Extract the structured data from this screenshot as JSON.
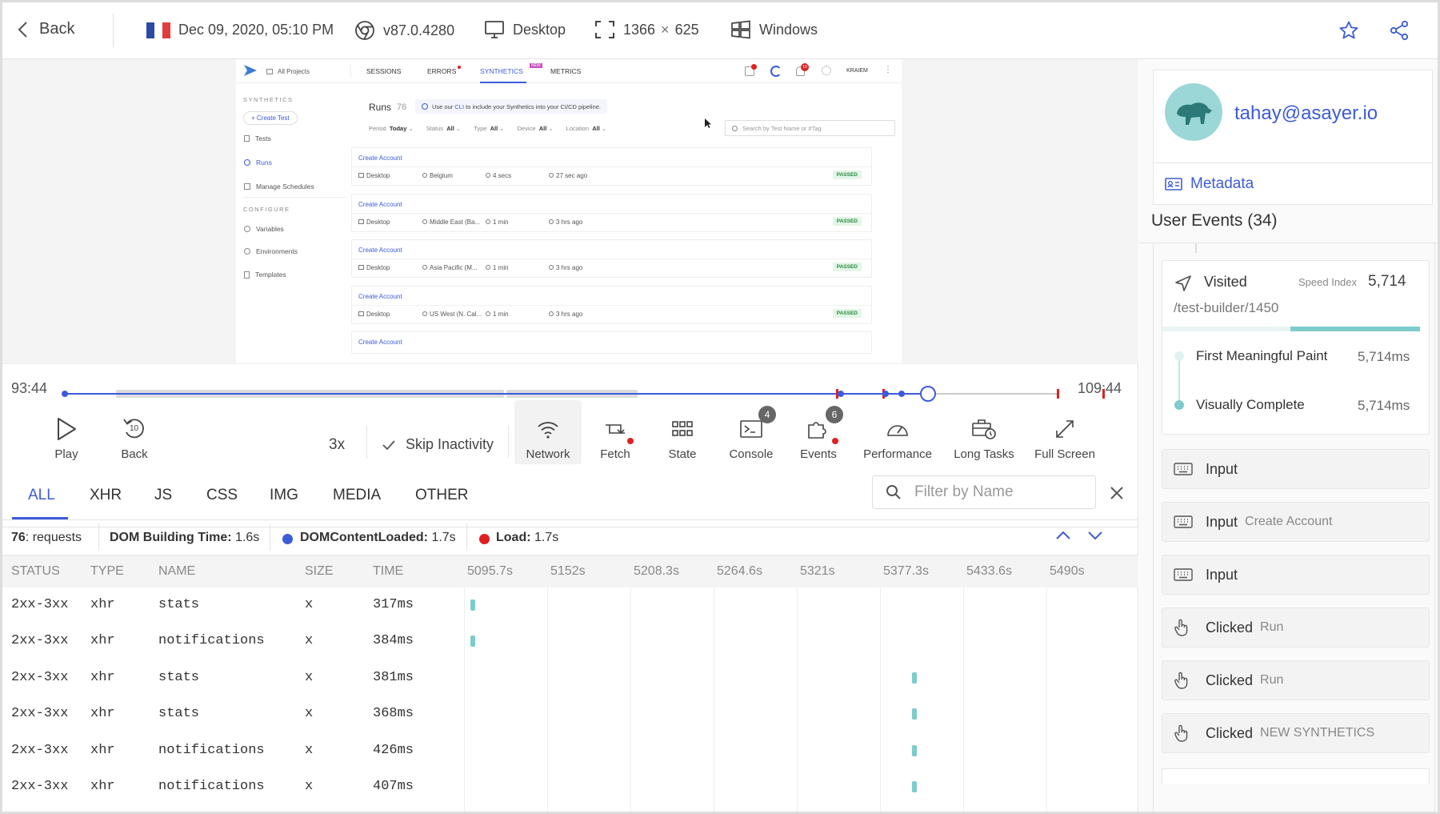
{
  "topbar": {
    "back_label": "Back",
    "date": "Dec 09, 2020, 05:10 PM",
    "browser_version": "v87.0.4280",
    "device": "Desktop",
    "resolution_w": "1366",
    "resolution_x": "×",
    "resolution_h": "625",
    "os": "Windows"
  },
  "recording": {
    "app": {
      "project": "All Projects",
      "nav": [
        "SESSIONS",
        "ERRORS",
        "SYNTHETICS",
        "METRICS"
      ],
      "new_badge": "NEW",
      "user": "KRAIEM",
      "notif_count": "10",
      "sidebar": {
        "section1": "SYNTHETICS",
        "create_test": "+ Create Test",
        "items1": [
          "Tests",
          "Runs",
          "Manage Schedules"
        ],
        "section2": "CONFIGURE",
        "items2": [
          "Variables",
          "Environments",
          "Templates"
        ]
      },
      "runs_title": "Runs",
      "runs_count": "76",
      "info_prefix": "Use our",
      "info_link": "CLI",
      "info_suffix": "to include your Synthetics into your CI/CD pipeline.",
      "filters": [
        {
          "label": "Period",
          "value": "Today"
        },
        {
          "label": "Status",
          "value": "All"
        },
        {
          "label": "Type",
          "value": "All"
        },
        {
          "label": "Device",
          "value": "All"
        },
        {
          "label": "Location",
          "value": "All"
        }
      ],
      "search_placeholder": "Search by Test Name or #Tag",
      "runs": [
        {
          "title": "Create Account",
          "device": "Desktop",
          "location": "Belgium",
          "duration": "4 secs",
          "ago": "27 sec ago",
          "status": "PASSED"
        },
        {
          "title": "Create Account",
          "device": "Desktop",
          "location": "Middle East (Ba...",
          "duration": "1 min",
          "ago": "3 hrs ago",
          "status": "PASSED"
        },
        {
          "title": "Create Account",
          "device": "Desktop",
          "location": "Asia Pacific (M...",
          "duration": "1 min",
          "ago": "3 hrs ago",
          "status": "PASSED"
        },
        {
          "title": "Create Account",
          "device": "Desktop",
          "location": "US West (N. Cal...",
          "duration": "1 min",
          "ago": "3 hrs ago",
          "status": "PASSED"
        },
        {
          "title": "Create Account",
          "device": "",
          "location": "",
          "duration": "",
          "ago": "",
          "status": ""
        }
      ]
    }
  },
  "timeline": {
    "start": "93:44",
    "end": "109:44",
    "played_fraction": 0.87
  },
  "controls": {
    "play": "Play",
    "back": "Back",
    "back_seconds": "10",
    "speed": "3x",
    "skip": "Skip Inactivity",
    "tools": [
      {
        "label": "Network",
        "badge": ""
      },
      {
        "label": "Fetch",
        "badge": ""
      },
      {
        "label": "State",
        "badge": ""
      },
      {
        "label": "Console",
        "badge": "4"
      },
      {
        "label": "Events",
        "badge": "6"
      },
      {
        "label": "Performance",
        "badge": ""
      },
      {
        "label": "Long Tasks",
        "badge": ""
      },
      {
        "label": "Full Screen",
        "badge": ""
      }
    ]
  },
  "network": {
    "tabs": [
      "ALL",
      "XHR",
      "JS",
      "CSS",
      "IMG",
      "MEDIA",
      "OTHER"
    ],
    "filter_placeholder": "Filter by Name",
    "stats": {
      "requests_count": "76",
      "requests_label": ": requests",
      "dom_label": "DOM Building Time:",
      "dom_value": "1.6s",
      "dcl_label": "DOMContentLoaded:",
      "dcl_value": "1.7s",
      "load_label": "Load:",
      "load_value": "1.7s"
    },
    "columns": [
      "STATUS",
      "TYPE",
      "NAME",
      "SIZE",
      "TIME"
    ],
    "ticks": [
      "5095.7s",
      "5152s",
      "5208.3s",
      "5264.6s",
      "5321s",
      "5377.3s",
      "5433.6s",
      "5490s"
    ],
    "rows": [
      {
        "status": "2xx-3xx",
        "type": "xhr",
        "name": "stats",
        "size": "x",
        "time": "317ms",
        "start": 5100
      },
      {
        "status": "2xx-3xx",
        "type": "xhr",
        "name": "notifications",
        "size": "x",
        "time": "384ms",
        "start": 5100
      },
      {
        "status": "2xx-3xx",
        "type": "xhr",
        "name": "stats",
        "size": "x",
        "time": "381ms",
        "start": 5399
      },
      {
        "status": "2xx-3xx",
        "type": "xhr",
        "name": "stats",
        "size": "x",
        "time": "368ms",
        "start": 5399
      },
      {
        "status": "2xx-3xx",
        "type": "xhr",
        "name": "notifications",
        "size": "x",
        "time": "426ms",
        "start": 5399
      },
      {
        "status": "2xx-3xx",
        "type": "xhr",
        "name": "notifications",
        "size": "x",
        "time": "407ms",
        "start": 5399
      }
    ]
  },
  "user": {
    "email": "tahay@asayer.io",
    "metadata_label": "Metadata"
  },
  "events": {
    "title": "User Events (34)",
    "visited_label": "Visited",
    "speed_index_label": "Speed Index",
    "speed_index_value": "5,714",
    "url": "/test-builder/1450",
    "fmp_label": "First Meaningful Paint",
    "fmp_value": "5,714ms",
    "vc_label": "Visually Complete",
    "vc_value": "5,714ms",
    "items": [
      {
        "type": "input",
        "label": "Input",
        "detail": ""
      },
      {
        "type": "input",
        "label": "Input",
        "detail": "Create Account"
      },
      {
        "type": "input",
        "label": "Input",
        "detail": ""
      },
      {
        "type": "click",
        "label": "Clicked",
        "detail": "Run"
      },
      {
        "type": "click",
        "label": "Clicked",
        "detail": "Run"
      },
      {
        "type": "click",
        "label": "Clicked",
        "detail": "NEW SYNTHETICS"
      }
    ]
  },
  "colors": {
    "accent": "#3d5bd9",
    "teal": "#7ccccc",
    "error": "#e02020"
  }
}
